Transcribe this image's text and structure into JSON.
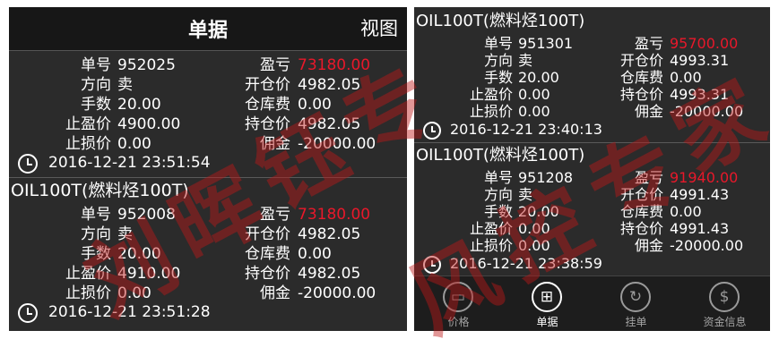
{
  "left": {
    "header": {
      "title": "单据",
      "view": "视图"
    },
    "orders": [
      {
        "symbol": "",
        "fields": [
          {
            "label": "单号",
            "value": "952025"
          },
          {
            "label": "方向",
            "value": "卖"
          },
          {
            "label": "手数",
            "value": "20.00"
          },
          {
            "label": "止盈价",
            "value": "4900.00"
          },
          {
            "label": "止损价",
            "value": "0.00"
          }
        ],
        "fields2": [
          {
            "label": "盈亏",
            "value": "73180.00"
          },
          {
            "label": "开仓价",
            "value": "4982.05"
          },
          {
            "label": "仓库费",
            "value": "0.00"
          },
          {
            "label": "持仓价",
            "value": "4982.05"
          },
          {
            "label": "佣金",
            "value": "-20000.00"
          }
        ],
        "time": "2016-12-21 23:51:54"
      },
      {
        "symbol": "OIL100T(燃料烃100T)",
        "fields": [
          {
            "label": "单号",
            "value": "952008"
          },
          {
            "label": "方向",
            "value": "卖"
          },
          {
            "label": "手数",
            "value": "20.00"
          },
          {
            "label": "止盈价",
            "value": "4910.00"
          },
          {
            "label": "止损价",
            "value": "0.00"
          }
        ],
        "fields2": [
          {
            "label": "盈亏",
            "value": "73180.00"
          },
          {
            "label": "开仓价",
            "value": "4982.05"
          },
          {
            "label": "仓库费",
            "value": "0.00"
          },
          {
            "label": "持仓价",
            "value": "4982.05"
          },
          {
            "label": "佣金",
            "value": "-20000.00"
          }
        ],
        "time": "2016-12-21 23:51:28"
      }
    ]
  },
  "right": {
    "orders": [
      {
        "symbol": "OIL100T(燃料烃100T)",
        "fields": [
          {
            "label": "单号",
            "value": "951301"
          },
          {
            "label": "方向",
            "value": "卖"
          },
          {
            "label": "手数",
            "value": "20.00"
          },
          {
            "label": "止盈价",
            "value": "0.00"
          },
          {
            "label": "止损价",
            "value": "0.00"
          }
        ],
        "fields2": [
          {
            "label": "盈亏",
            "value": "95700.00"
          },
          {
            "label": "开仓价",
            "value": "4993.31"
          },
          {
            "label": "仓库费",
            "value": "0.00"
          },
          {
            "label": "持仓价",
            "value": "4993.31"
          },
          {
            "label": "佣金",
            "value": "-20000.00"
          }
        ],
        "time": "2016-12-21 23:40:13"
      },
      {
        "symbol": "OIL100T(燃料烃100T)",
        "fields": [
          {
            "label": "单号",
            "value": "951208"
          },
          {
            "label": "方向",
            "value": "卖"
          },
          {
            "label": "手数",
            "value": "20.00"
          },
          {
            "label": "止盈价",
            "value": "0.00"
          },
          {
            "label": "止损价",
            "value": "0.00"
          }
        ],
        "fields2": [
          {
            "label": "盈亏",
            "value": "91940.00"
          },
          {
            "label": "开仓价",
            "value": "4991.43"
          },
          {
            "label": "仓库费",
            "value": "0.00"
          },
          {
            "label": "持仓价",
            "value": "4991.43"
          },
          {
            "label": "佣金",
            "value": "-20000.00"
          }
        ],
        "time": "2016-12-21 23:38:59"
      }
    ],
    "nav": [
      {
        "label": "价格",
        "icon": "monitor-icon"
      },
      {
        "label": "单据",
        "icon": "basket-icon",
        "active": true
      },
      {
        "label": "挂单",
        "icon": "refresh-icon"
      },
      {
        "label": "资金信息",
        "icon": "dollar-icon"
      }
    ]
  },
  "watermark": [
    "刘",
    "晖",
    "钰",
    "专",
    "风",
    "控",
    "专",
    "家"
  ],
  "colors": {
    "profit": "#e8182a",
    "background": "#2b2b2b"
  }
}
